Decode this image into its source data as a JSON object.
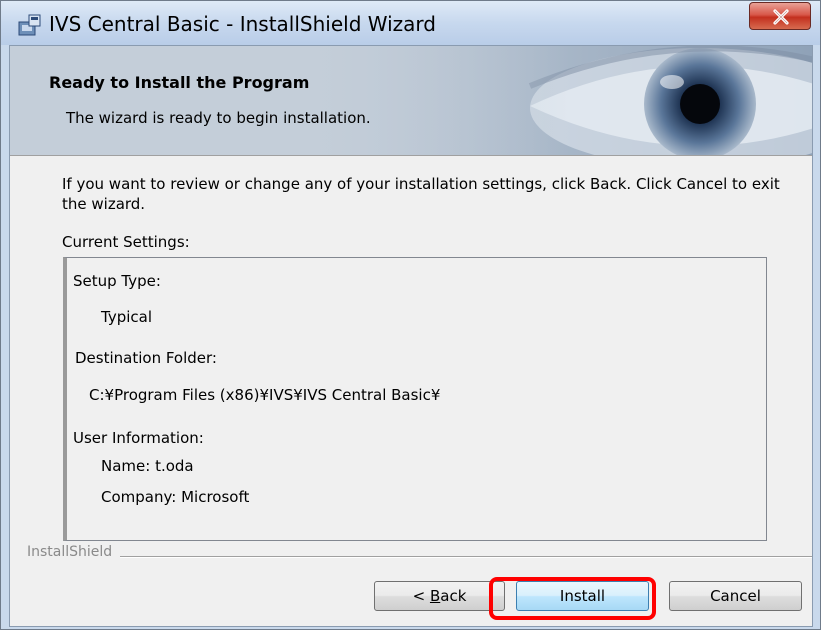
{
  "window": {
    "title": "IVS Central Basic - InstallShield Wizard",
    "icons": {
      "app": "installer-app-icon",
      "close": "close-icon"
    },
    "accent_close_color": "#d8584a"
  },
  "banner": {
    "title": "Ready to Install the Program",
    "subtitle": "The wizard is ready to begin installation.",
    "image": "eye-banner-image"
  },
  "instructions": "If you want to review or change any of your installation settings, click Back. Click Cancel to exit the wizard.",
  "current_settings_label": "Current Settings:",
  "settings": {
    "setup_type_label": "Setup Type:",
    "setup_type_value": "Typical",
    "destination_label": "Destination Folder:",
    "destination_value": "C:¥Program Files (x86)¥IVS¥IVS Central Basic¥",
    "user_info_label": "User Information:",
    "name": "Name: t.oda",
    "company": "Company: Microsoft"
  },
  "footer": {
    "brand": "InstallShield"
  },
  "buttons": {
    "back_label": "< Back",
    "back_mnemonic": "B",
    "install_label": "Install",
    "cancel_label": "Cancel"
  },
  "annotation": {
    "highlight_color": "#ff0000",
    "highlight_target": "install-button"
  }
}
